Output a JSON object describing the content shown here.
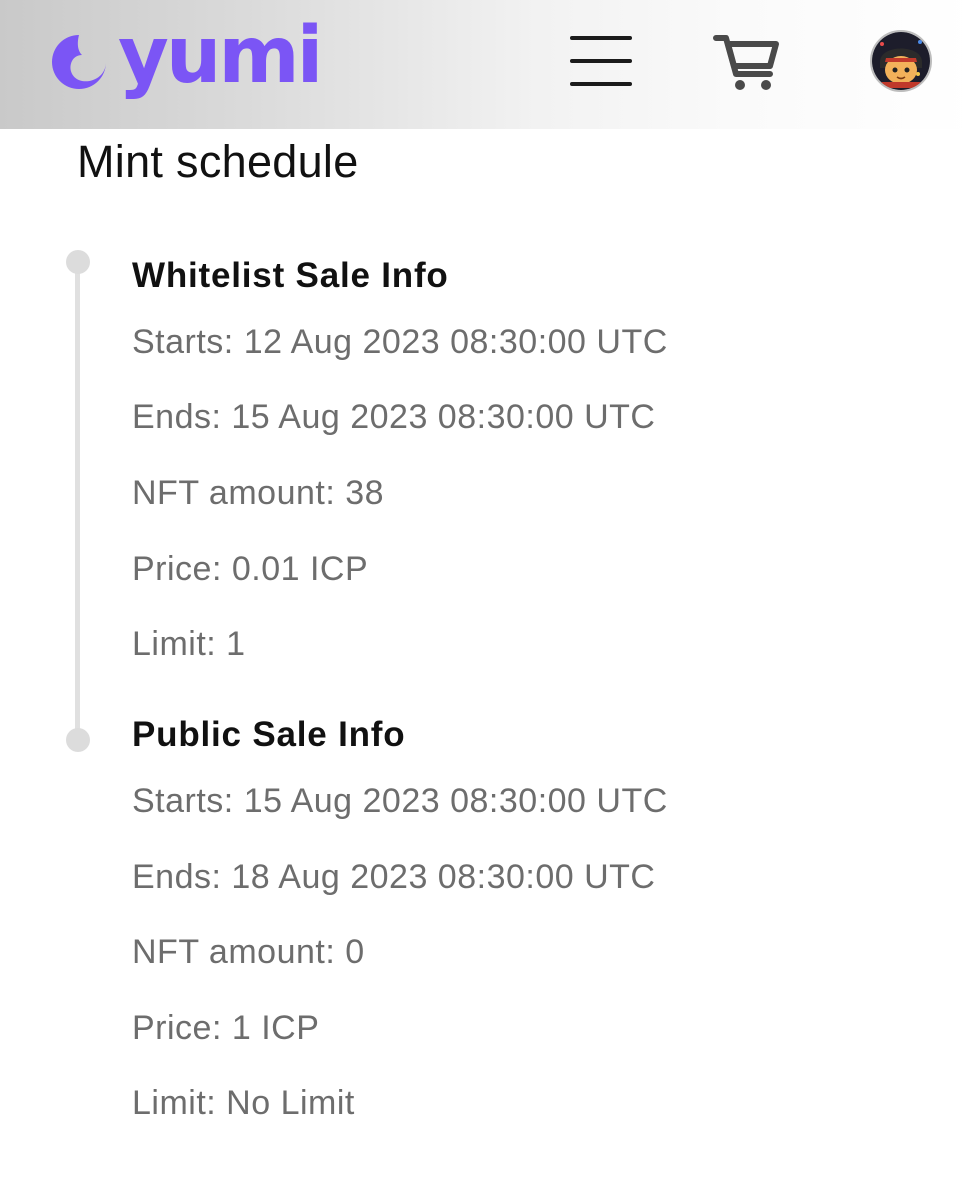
{
  "header": {
    "logo_text": "yumi",
    "brand_color": "#7b55f5",
    "menu_icon": "hamburger-menu-icon",
    "cart_icon": "shopping-cart-icon",
    "avatar": "user-avatar"
  },
  "page": {
    "title": "Mint schedule"
  },
  "sections": [
    {
      "title": "Whitelist Sale Info",
      "lines": [
        "Starts: 12 Aug 2023 08:30:00 UTC",
        "Ends: 15 Aug 2023 08:30:00 UTC",
        "NFT amount: 38",
        "Price: 0.01 ICP",
        "Limit: 1"
      ]
    },
    {
      "title": "Public Sale Info",
      "lines": [
        "Starts: 15 Aug 2023 08:30:00 UTC",
        "Ends: 18 Aug 2023 08:30:00 UTC",
        "NFT amount: 0",
        "Price: 1 ICP",
        "Limit: No Limit"
      ]
    }
  ]
}
